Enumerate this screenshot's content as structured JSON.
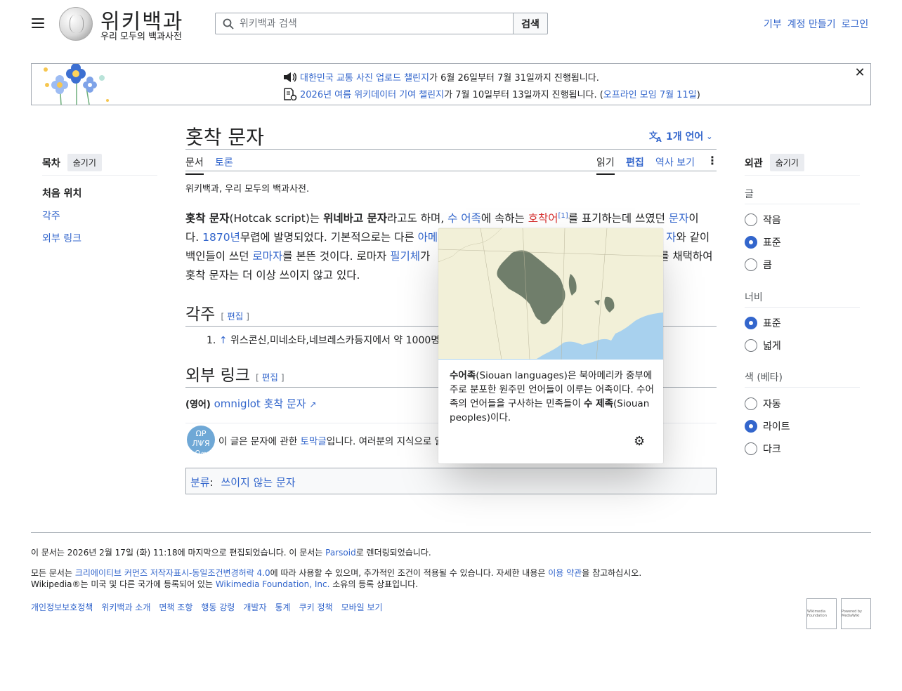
{
  "header": {
    "wordmark": "위키백과",
    "tagline": "우리 모두의 백과사전",
    "search_placeholder": "위키백과 검색",
    "search_button": "검색",
    "user_links": [
      "기부",
      "계정 만들기",
      "로그인"
    ]
  },
  "banner": {
    "line1_link": "대한민국 교통 사진 업로드 챌린지",
    "line1_text": "가 6월 26일부터 7월 31일까지 진행됩니다.",
    "line2_link": "2026년 여름 위키데이터 기여 챌린지",
    "line2_text": "가 7월 10일부터 13일까지 진행됩니다. (",
    "line2_link2": "오프라인 모임 7월 11일",
    "line2_end": ")"
  },
  "toc": {
    "title": "목차",
    "hide": "숨기기",
    "items": [
      "처음 위치",
      "각주",
      "외부 링크"
    ]
  },
  "article": {
    "title": "홋착 문자",
    "languages": "1개 언어",
    "tabs": {
      "doc": "문서",
      "talk": "토론",
      "read": "읽기",
      "edit": "편집",
      "history": "역사 보기"
    },
    "site_sub": "위키백과, 우리 모두의 백과사전.",
    "intro": {
      "p1_bold": "홋착 문자",
      "p1_a": "(Hotcak script)는 ",
      "p1_bold2": "위네바고 문자",
      "p1_b": "라고도 하며, ",
      "link_siouan": "수 어족",
      "p1_c": "에 속하는 ",
      "link_hocak": "호착어",
      "ref1": "[1]",
      "p1_d": "를 표기하는데 쓰였던 ",
      "link_script": "문자",
      "p1_e": "이",
      "p2_a": "다. ",
      "link_1870": "1870년",
      "p2_b": "무렵에 발명되었다. 기본적으로는 다른 ",
      "link_ame": "아메",
      "p2_c_after": "자",
      "p2_d": "와 같이",
      "p3_a": "백인들이 쓰던 ",
      "link_roman": "로마자",
      "p3_b": "를 본뜬 것이다. 로마자 ",
      "link_cursive": "필기체",
      "p3_c": "가",
      "p3_d": "를 채택하여",
      "p4": "홋착 문자는 더 이상 쓰이지 않고 있다."
    },
    "notes_heading": "각주",
    "edit_label": "편집",
    "note_1_num": "1.",
    "note_1_arrow": "↑",
    "note_1_text": "위스콘신,미네소타,네브레스카등지에서 약 1000명",
    "ext_heading": "외부 링크",
    "ext_lang": "(영어)",
    "ext_link": "omniglot 홋착 문자",
    "stub_a": "이 글은 문자에 관한 ",
    "stub_link": "토막글",
    "stub_b": "입니다. 여러분의 지식으로 알",
    "stub_icon_text": "ΩP ЛѰЯ ♀∞",
    "category_label": "분류",
    "category": "쓰이지 않는 문자"
  },
  "popup": {
    "bold1": "수어족",
    "t1": "(Siouan languages)은 북아메리카 중부에 주로 분포한 원주민 언어들이 이루는 어족이다. 수어족의 언어들을 구사하는 민족들이 ",
    "bold2": "수 제족",
    "t2": "(Siouan peoples)이다."
  },
  "appearance": {
    "title": "외관",
    "hide": "숨기기",
    "text_label": "글",
    "text_options": [
      "작음",
      "표준",
      "큼"
    ],
    "text_selected": 1,
    "width_label": "너비",
    "width_options": [
      "표준",
      "넓게"
    ],
    "width_selected": 0,
    "color_label": "색 (베타)",
    "color_options": [
      "자동",
      "라이트",
      "다크"
    ],
    "color_selected": 1
  },
  "footer": {
    "line1_a": "이 문서는 2026년 2월 17일 (화) 11:18에 마지막으로 편집되었습니다. 이 문서는 ",
    "line1_link": "Parsoid",
    "line1_b": "로 렌더링되었습니다.",
    "line2_a": "모든 문서는 ",
    "line2_link": "크리에이티브 커먼즈 저작자표시-동일조건변경허락 4.0",
    "line2_b": "에 따라 사용할 수 있으며, 추가적인 조건이 적용될 수 있습니다. 자세한 내용은 ",
    "line2_link2": "이용 약관",
    "line2_c": "을 참고하십시오.",
    "line3_a": "Wikipedia®는 미국 및 다른 국가에 등록되어 있는 ",
    "line3_link": "Wikimedia Foundation, Inc.",
    "line3_b": " 소유의 등록 상표입니다.",
    "links": [
      "개인정보보호정책",
      "위키백과 소개",
      "면책 조항",
      "행동 강령",
      "개발자",
      "통계",
      "쿠키 정책",
      "모바일 보기"
    ],
    "badge_wmf": "Wikimedia Foundation",
    "badge_mw": "Powered by MediaWiki"
  },
  "colors": {
    "link": "#3366cc",
    "redlink": "#d73333",
    "map_land": "#f2f0d8",
    "map_water": "#a8d1ee",
    "map_region": "#707e6b"
  }
}
